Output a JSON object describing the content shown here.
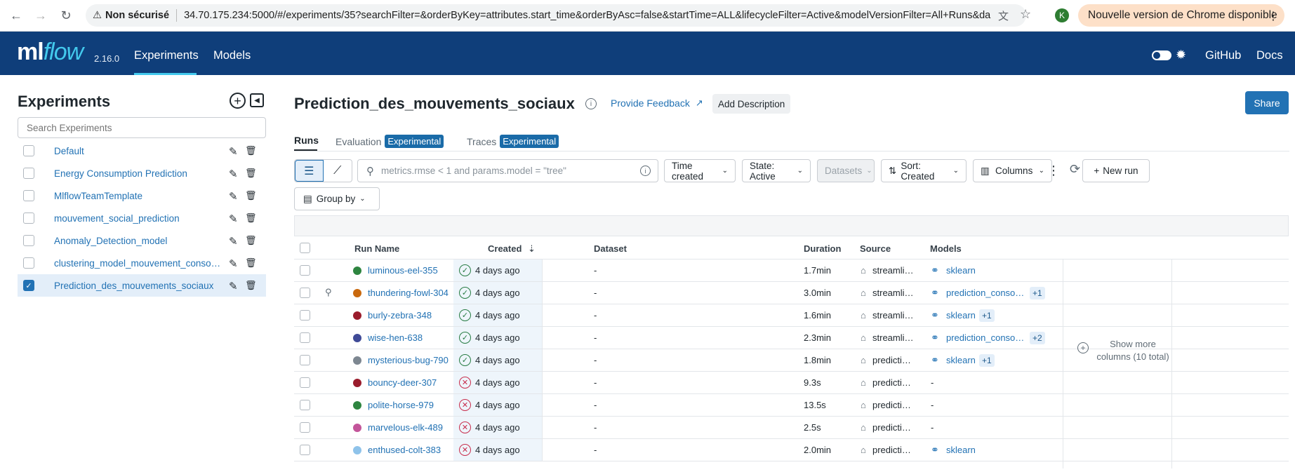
{
  "browser": {
    "security_label": "Non sécurisé",
    "url": "34.70.175.234:5000/#/experiments/35?searchFilter=&orderByKey=attributes.start_time&orderByAsc=false&startTime=ALL&lifecycleFilter=Active&modelVersionFilter=All+Runs&da...",
    "profile_initial": "K",
    "update_label": "Nouvelle version de Chrome disponible"
  },
  "header": {
    "logo_ml": "ml",
    "logo_flow": "flow",
    "version": "2.16.0",
    "nav": [
      "Experiments",
      "Models"
    ],
    "right_links": [
      "GitHub",
      "Docs"
    ]
  },
  "sidebar": {
    "title": "Experiments",
    "search_placeholder": "Search Experiments",
    "items": [
      {
        "name": "Default",
        "selected": false
      },
      {
        "name": "Energy Consumption Prediction",
        "selected": false
      },
      {
        "name": "MlflowTeamTemplate",
        "selected": false
      },
      {
        "name": "mouvement_social_prediction",
        "selected": false
      },
      {
        "name": "Anomaly_Detection_model",
        "selected": false
      },
      {
        "name": "clustering_model_mouvement_consommation",
        "selected": false
      },
      {
        "name": "Prediction_des_mouvements_sociaux",
        "selected": true
      }
    ]
  },
  "main": {
    "title": "Prediction_des_mouvements_sociaux",
    "feedback_label": "Provide Feedback",
    "add_description_label": "Add Description",
    "share_label": "Share",
    "tabs": [
      {
        "label": "Runs",
        "badge": ""
      },
      {
        "label": "Evaluation",
        "badge": "Experimental"
      },
      {
        "label": "Traces",
        "badge": "Experimental"
      }
    ],
    "search_placeholder": "metrics.rmse < 1 and params.model = \"tree\"",
    "filters": {
      "time": "Time created",
      "state": "State: Active",
      "datasets": "Datasets",
      "sort": "Sort: Created",
      "columns": "Columns"
    },
    "new_run_label": "New run",
    "group_by_label": "Group by",
    "show_more_columns": "Show more columns (10 total)"
  },
  "table": {
    "columns": [
      "Run Name",
      "Created",
      "Dataset",
      "Duration",
      "Source",
      "Models"
    ],
    "rows": [
      {
        "name": "luminous-eel-355",
        "color": "#2e8540",
        "status": "ok",
        "created": "4 days ago",
        "dataset": "-",
        "duration": "1.7min",
        "source": "streamlit_app.py",
        "model": "sklearn",
        "model_extra": "",
        "pinned": false
      },
      {
        "name": "thundering-fowl-304",
        "color": "#c9690e",
        "status": "ok",
        "created": "4 days ago",
        "dataset": "-",
        "duration": "3.0min",
        "source": "streamlit_app.py",
        "model": "prediction_conso_model",
        "model_extra": "+1",
        "pinned": true
      },
      {
        "name": "burly-zebra-348",
        "color": "#9a1c2c",
        "status": "ok",
        "created": "4 days ago",
        "dataset": "-",
        "duration": "1.6min",
        "source": "streamlit_app.py",
        "model": "sklearn",
        "model_extra": "+1",
        "pinned": false
      },
      {
        "name": "wise-hen-638",
        "color": "#3f4a97",
        "status": "ok",
        "created": "4 days ago",
        "dataset": "-",
        "duration": "2.3min",
        "source": "streamlit_app.py",
        "model": "prediction_conso_model",
        "model_extra": "+2",
        "pinned": false
      },
      {
        "name": "mysterious-bug-790",
        "color": "#7d8791",
        "status": "ok",
        "created": "4 days ago",
        "dataset": "-",
        "duration": "1.8min",
        "source": "prediction.py",
        "model": "sklearn",
        "model_extra": "+1",
        "pinned": false
      },
      {
        "name": "bouncy-deer-307",
        "color": "#9a1c2c",
        "status": "fail",
        "created": "4 days ago",
        "dataset": "-",
        "duration": "9.3s",
        "source": "prediction.py",
        "model": "-",
        "model_extra": "",
        "pinned": false
      },
      {
        "name": "polite-horse-979",
        "color": "#2e8540",
        "status": "fail",
        "created": "4 days ago",
        "dataset": "-",
        "duration": "13.5s",
        "source": "prediction.py",
        "model": "-",
        "model_extra": "",
        "pinned": false
      },
      {
        "name": "marvelous-elk-489",
        "color": "#c3559a",
        "status": "fail",
        "created": "4 days ago",
        "dataset": "-",
        "duration": "2.5s",
        "source": "prediction.py",
        "model": "-",
        "model_extra": "",
        "pinned": false
      },
      {
        "name": "enthused-colt-383",
        "color": "#8fc3ea",
        "status": "fail",
        "created": "4 days ago",
        "dataset": "-",
        "duration": "2.0min",
        "source": "prediction.py",
        "model": "sklearn",
        "model_extra": "",
        "pinned": false
      }
    ]
  },
  "colors": {
    "header_bg": "#0f3e7a",
    "accent": "#2272b4",
    "logo_accent": "#43c9ed"
  }
}
